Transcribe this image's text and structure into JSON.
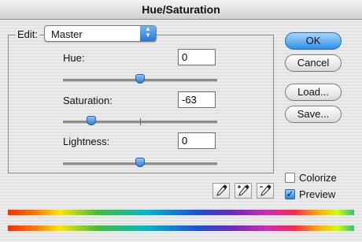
{
  "window": {
    "title": "Hue/Saturation"
  },
  "edit": {
    "label": "Edit:",
    "selected": "Master",
    "popup_icon": "up-down-arrows-icon"
  },
  "adjustments": {
    "hue": {
      "label": "Hue:",
      "value": "0",
      "slider_fraction": 0.5
    },
    "saturation": {
      "label": "Saturation:",
      "value": "-63",
      "slider_fraction": 0.185
    },
    "lightness": {
      "label": "Lightness:",
      "value": "0",
      "slider_fraction": 0.5
    }
  },
  "buttons": {
    "ok": "OK",
    "cancel": "Cancel",
    "load": "Load...",
    "save": "Save..."
  },
  "eyedroppers": [
    "eyedropper-icon",
    "eyedropper-plus-icon",
    "eyedropper-minus-icon"
  ],
  "options": {
    "colorize": {
      "label": "Colorize",
      "checked": false
    },
    "preview": {
      "label": "Preview",
      "checked": true
    }
  }
}
